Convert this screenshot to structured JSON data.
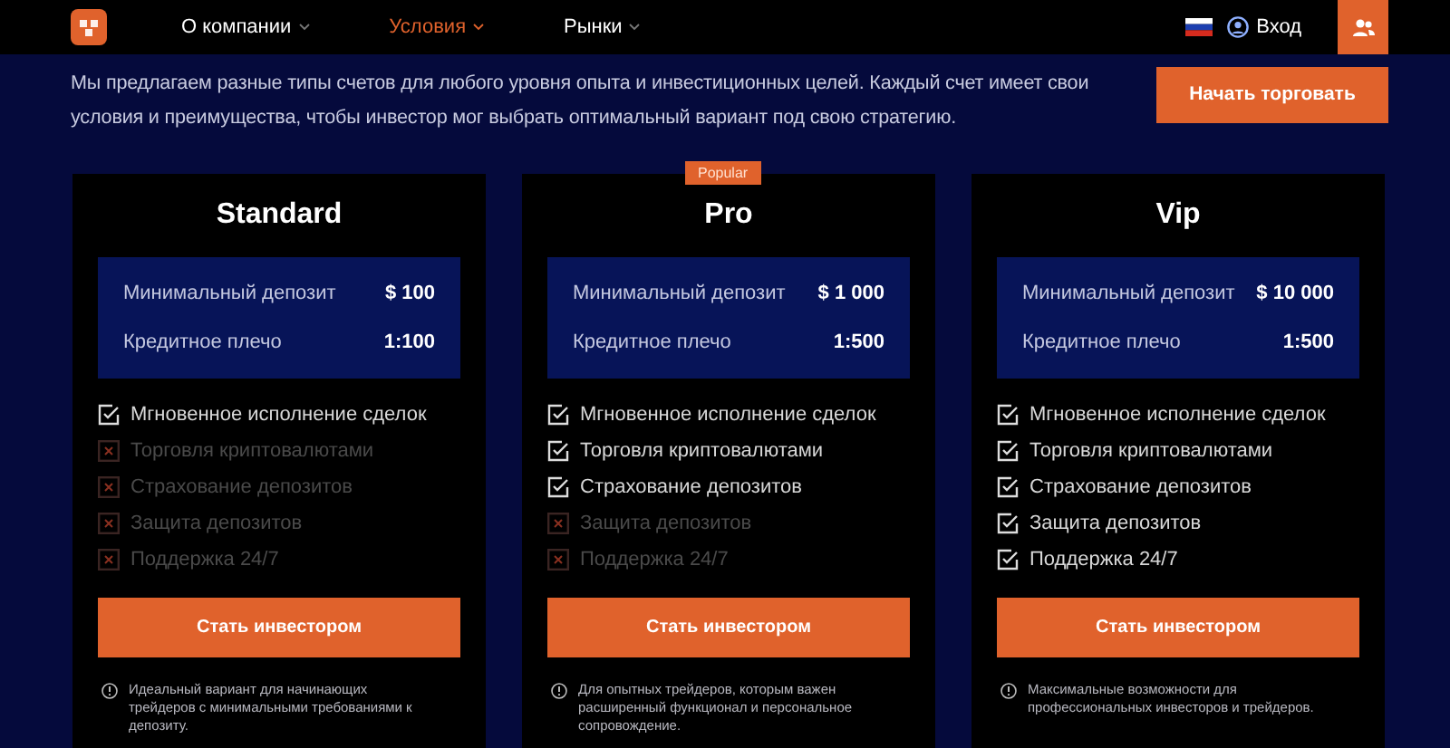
{
  "header": {
    "nav": [
      {
        "label": "О компании",
        "selected": false
      },
      {
        "label": "Условия",
        "selected": true
      },
      {
        "label": "Рынки",
        "selected": false
      }
    ],
    "login": "Вход"
  },
  "intro": {
    "text": "Мы предлагаем разные типы счетов для любого уровня опыта и инвестиционных целей. Каждый счет имеет свои условия и преимущества, чтобы инвестор мог выбрать оптимальный вариант под свою стратегию.",
    "button": "Начать торговать"
  },
  "plans": [
    {
      "name": "Standard",
      "specs": [
        {
          "label": "Минимальный депозит",
          "value": "$ 100"
        },
        {
          "label": "Кредитное плечо",
          "value": "1:100"
        }
      ],
      "features": [
        {
          "label": "Мгновенное исполнение сделок",
          "checked": true
        },
        {
          "label": "Торговля криптовалютами",
          "checked": false
        },
        {
          "label": "Страхование депозитов",
          "checked": false
        },
        {
          "label": "Защита депозитов",
          "checked": false
        },
        {
          "label": "Поддержка 24/7",
          "checked": false
        }
      ],
      "button": "Стать инвестором",
      "note": "Идеальный вариант для начинающих трейдеров с минимальными требованиями к депозиту."
    },
    {
      "name": "Pro",
      "badge": "Popular",
      "specs": [
        {
          "label": "Минимальный депозит",
          "value": "$ 1 000"
        },
        {
          "label": "Кредитное плечо",
          "value": "1:500"
        }
      ],
      "features": [
        {
          "label": "Мгновенное исполнение сделок",
          "checked": true
        },
        {
          "label": "Торговля криптовалютами",
          "checked": true
        },
        {
          "label": "Страхование депозитов",
          "checked": true
        },
        {
          "label": "Защита депозитов",
          "checked": false
        },
        {
          "label": "Поддержка 24/7",
          "checked": false
        }
      ],
      "button": "Стать инвестором",
      "note": "Для опытных трейдеров, которым важен расширенный функционал и персональное сопровождение."
    },
    {
      "name": "Vip",
      "specs": [
        {
          "label": "Минимальный депозит",
          "value": "$ 10 000"
        },
        {
          "label": "Кредитное плечо",
          "value": "1:500"
        }
      ],
      "features": [
        {
          "label": "Мгновенное исполнение сделок",
          "checked": true
        },
        {
          "label": "Торговля криптовалютами",
          "checked": true
        },
        {
          "label": "Страхование депозитов",
          "checked": true
        },
        {
          "label": "Защита депозитов",
          "checked": true
        },
        {
          "label": "Поддержка 24/7",
          "checked": true
        }
      ],
      "button": "Стать инвестором",
      "note": "Максимальные возможности для профессиональных инвесторов и трейдеров."
    }
  ]
}
